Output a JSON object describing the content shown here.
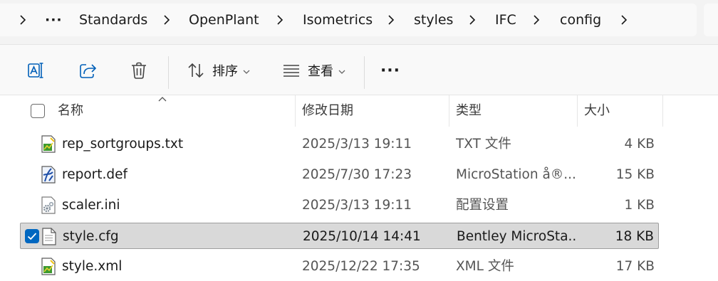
{
  "address_bar": {
    "overflow_label": "···",
    "crumbs": [
      "Standards",
      "OpenPlant",
      "Isometrics",
      "styles",
      "IFC",
      "config"
    ]
  },
  "toolbar": {
    "sort_label": "排序",
    "view_label": "查看",
    "more_label": "···"
  },
  "columns": {
    "name": "名称",
    "modified": "修改日期",
    "type": "类型",
    "size": "大小"
  },
  "files": [
    {
      "name": "rep_sortgroups.txt",
      "modified": "2025/3/13 19:11",
      "type": "TXT 文件",
      "size": "4 KB",
      "icon": "text-file-icon",
      "selected": false
    },
    {
      "name": "report.def",
      "modified": "2025/7/30 17:23",
      "type": "MicroStation å®...",
      "size": "15 KB",
      "icon": "microstation-file-icon",
      "selected": false
    },
    {
      "name": "scaler.ini",
      "modified": "2025/3/13 19:11",
      "type": "配置设置",
      "size": "1 KB",
      "icon": "settings-file-icon",
      "selected": false
    },
    {
      "name": "style.cfg",
      "modified": "2025/10/14 14:41",
      "type": "Bentley MicroSta...",
      "size": "18 KB",
      "icon": "blank-file-icon",
      "selected": true
    },
    {
      "name": "style.xml",
      "modified": "2025/12/22 17:35",
      "type": "XML 文件",
      "size": "17 KB",
      "icon": "text-file-icon",
      "selected": false
    }
  ],
  "colors": {
    "accent": "#0067c0",
    "selection_bg": "#d9d9d9"
  }
}
